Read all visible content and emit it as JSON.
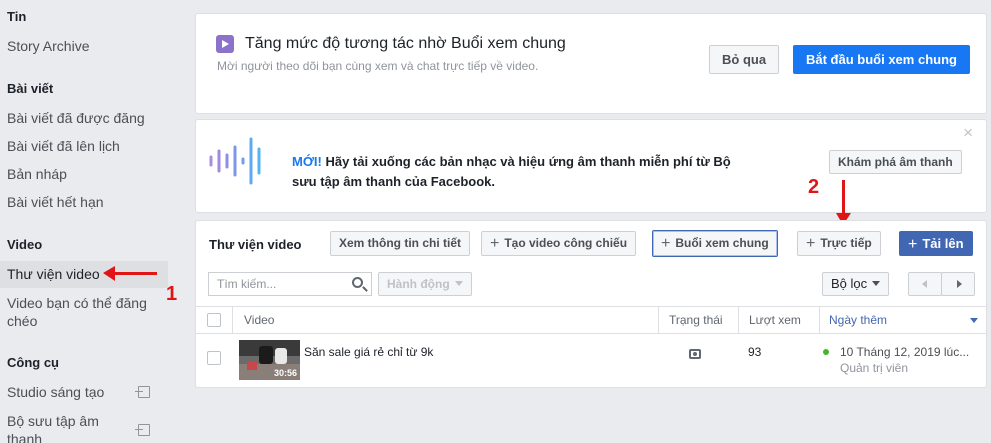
{
  "sidebar": {
    "sections": [
      {
        "heading": "Tin",
        "items": [
          "Story Archive"
        ]
      },
      {
        "heading": "Bài viết",
        "items": [
          "Bài viết đã được đăng",
          "Bài viết đã lên lịch",
          "Bản nháp",
          "Bài viết hết hạn"
        ]
      },
      {
        "heading": "Video",
        "items": [
          "Thư viện video",
          "Video bạn có thể đăng chéo"
        ]
      },
      {
        "heading": "Công cụ",
        "items": [
          "Studio sáng tạo",
          "Bộ sưu tập âm thanh"
        ]
      }
    ]
  },
  "watch_party_promo": {
    "title": "Tăng mức độ tương tác nhờ Buổi xem chung",
    "subtitle": "Mời người theo dõi bạn cùng xem và chat trực tiếp về video.",
    "skip_label": "Bỏ qua",
    "start_label": "Bắt đầu buổi xem chung"
  },
  "sound_promo": {
    "new_label": "MỚI!",
    "text_line1": " Hãy tải xuống các bản nhạc và hiệu ứng âm thanh miễn phí từ Bộ",
    "text_line2": "sưu tập âm thanh của Facebook.",
    "explore_label": "Khám phá âm thanh",
    "close_glyph": "×"
  },
  "library": {
    "title": "Thư viện video",
    "details_label": "Xem thông tin chi tiết",
    "create_video_label": "Tạo video công chiếu",
    "watch_party_label": "Buổi xem chung",
    "live_label": "Trực tiếp",
    "upload_label": "Tải lên",
    "search_placeholder": "Tìm kiếm...",
    "actions_label": "Hành động",
    "filter_label": "Bộ lọc",
    "columns": [
      "Video",
      "Trạng thái",
      "Lượt xem",
      "Ngày thêm"
    ],
    "rows": [
      {
        "title": "Săn sale giá rẻ chỉ từ 9k",
        "duration": "30:56",
        "views": "93",
        "date": "10 Tháng 12, 2019 lúc...",
        "added_by": "Quản trị viên"
      }
    ]
  },
  "annotations": {
    "one": "1",
    "two": "2"
  },
  "colors": {
    "accent": "#4267b2",
    "brand_blue": "#1877f2",
    "annotation": "#e01616",
    "status_green": "#42b72a"
  }
}
